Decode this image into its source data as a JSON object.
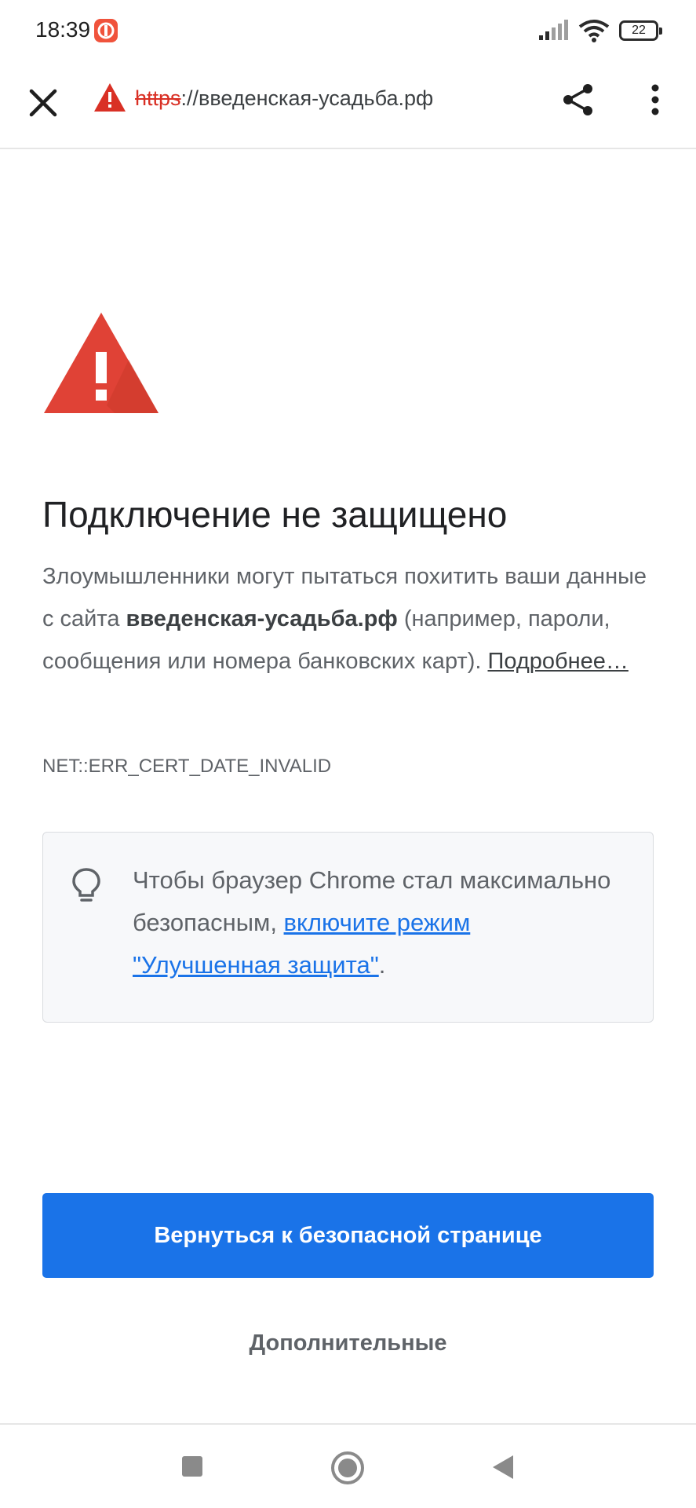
{
  "status_bar": {
    "time": "18:39",
    "battery": "22",
    "icons": [
      "app-notification-icon",
      "signal-icon",
      "wifi-icon",
      "battery-icon"
    ]
  },
  "toolbar": {
    "url_scheme": "https",
    "url_rest": "://введенская-усадьба.рф",
    "icons": [
      "close-icon",
      "not-secure-warning-icon",
      "share-icon",
      "more-vert-icon"
    ]
  },
  "interstitial": {
    "title": "Подключение не защищено",
    "body_part1": "Злоумышленники могут пытаться похитить ваши данные с сайта ",
    "body_domain": "введенская-усадьба.рф",
    "body_part2": " (например, пароли, сообщения или номера банковских карт). ",
    "learn_more": "Подробнее…",
    "error_code": "NET::ERR_CERT_DATE_INVALID"
  },
  "tip": {
    "text_prefix": "Чтобы браузер Chrome стал максимально безопасным, ",
    "link_text": "включите режим \"Улучшенная защита\"",
    "text_suffix": "."
  },
  "buttons": {
    "back_to_safety": "Вернуться к безопасной странице",
    "advanced": "Дополнительные"
  },
  "colors": {
    "danger": "#d93025",
    "primary": "#1a73e8",
    "warning_triangle": "#e04236"
  }
}
